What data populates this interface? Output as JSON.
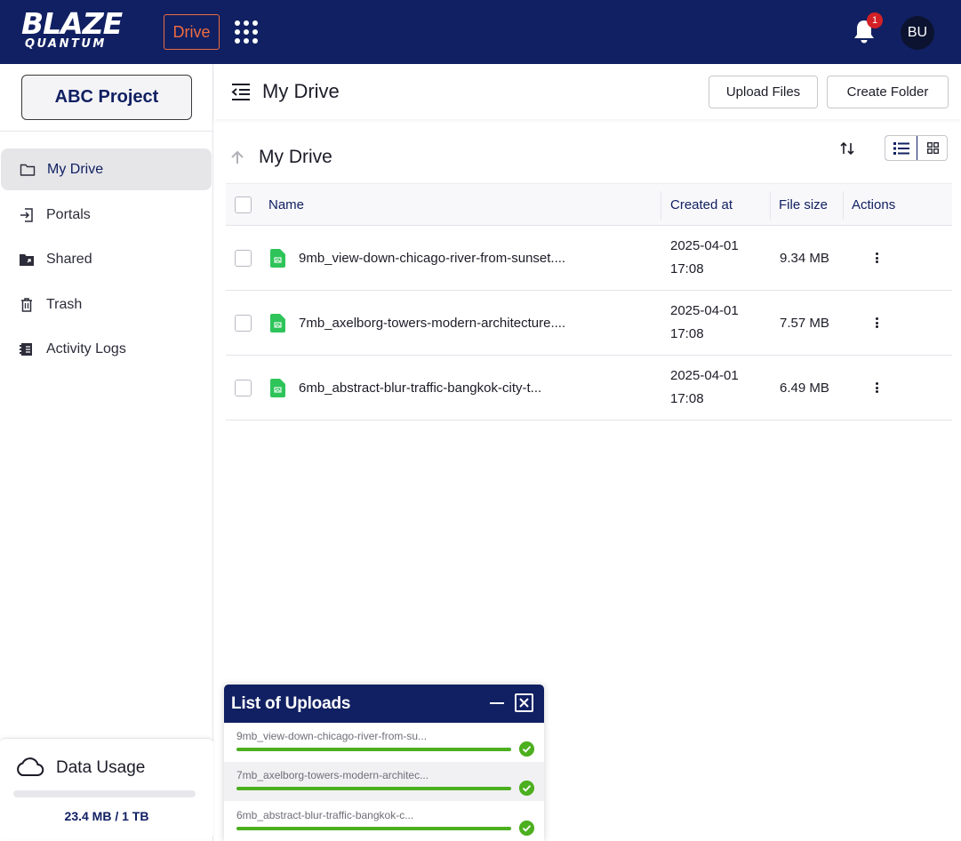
{
  "brand": {
    "logo_line1": "BLAZE",
    "logo_line2": "QUANTUM",
    "app_badge": "Drive",
    "accent": "#ee6b3f",
    "navy": "#112062"
  },
  "topbar": {
    "notifications_count": "1",
    "avatar_initials": "BU"
  },
  "sidebar": {
    "project_label": "ABC Project",
    "items": [
      {
        "label": "My Drive",
        "icon": "folder-icon",
        "active": true
      },
      {
        "label": "Portals",
        "icon": "portal-enter-icon"
      },
      {
        "label": "Shared",
        "icon": "shared-folder-icon"
      },
      {
        "label": "Trash",
        "icon": "trash-icon"
      },
      {
        "label": "Activity Logs",
        "icon": "activity-log-icon"
      }
    ],
    "data_usage": {
      "title": "Data Usage",
      "text": "23.4 MB / 1 TB",
      "fraction": 2.34e-05
    }
  },
  "header": {
    "title": "My Drive",
    "upload_label": "Upload Files",
    "create_folder_label": "Create Folder"
  },
  "breadcrumb": {
    "current": "My Drive"
  },
  "table": {
    "columns": [
      "Name",
      "Created at",
      "File size",
      "Actions"
    ],
    "rows": [
      {
        "name": "9mb_view-down-chicago-river-from-sunset....",
        "date": "2025-04-01",
        "time": "17:08",
        "size": "9.34 MB"
      },
      {
        "name": "7mb_axelborg-towers-modern-architecture....",
        "date": "2025-04-01",
        "time": "17:08",
        "size": "7.57 MB"
      },
      {
        "name": "6mb_abstract-blur-traffic-bangkok-city-t...",
        "date": "2025-04-01",
        "time": "17:08",
        "size": "6.49 MB"
      }
    ]
  },
  "uploads": {
    "title": "List of Uploads",
    "items": [
      {
        "name": "9mb_view-down-chicago-river-from-su...",
        "progress": 1.0
      },
      {
        "name": "7mb_axelborg-towers-modern-architec...",
        "progress": 1.0
      },
      {
        "name": "6mb_abstract-blur-traffic-bangkok-c...",
        "progress": 1.0
      }
    ]
  }
}
